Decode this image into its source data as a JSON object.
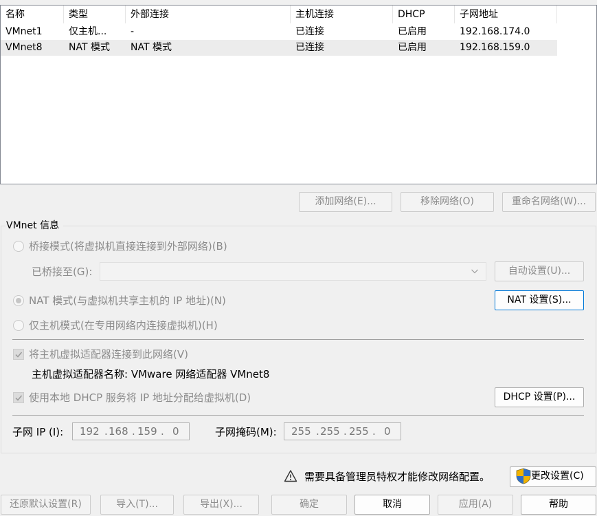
{
  "network_list": {
    "columns": [
      "名称",
      "类型",
      "外部连接",
      "主机连接",
      "DHCP",
      "子网地址"
    ],
    "rows": [
      {
        "name": "VMnet1",
        "type": "仅主机...",
        "external": "-",
        "host": "已连接",
        "dhcp": "已启用",
        "subnet": "192.168.174.0"
      },
      {
        "name": "VMnet8",
        "type": "NAT 模式",
        "external": "NAT 模式",
        "host": "已连接",
        "dhcp": "已启用",
        "subnet": "192.168.159.0"
      }
    ],
    "selected_row": "VMnet8"
  },
  "list_buttons": {
    "add": "添加网络(E)...",
    "remove": "移除网络(O)",
    "rename": "重命名网络(W)..."
  },
  "vmnet_info": {
    "title": "VMnet 信息",
    "bridged_label": "桥接模式(将虚拟机直接连接到外部网络)(B)",
    "bridged_to_label": "已桥接至(G):",
    "bridged_to_value": "",
    "auto_settings": "自动设置(U)...",
    "nat_label": "NAT 模式(与虚拟机共享主机的 IP 地址)(N)",
    "nat_settings": "NAT 设置(S)...",
    "host_only_label": "仅主机模式(在专用网络内连接虚拟机)(H)",
    "connect_adapter_label": "将主机虚拟适配器连接到此网络(V)",
    "adapter_name_text": "主机虚拟适配器名称: VMware 网络适配器 VMnet8",
    "dhcp_label": "使用本地 DHCP 服务将 IP 地址分配给虚拟机(D)",
    "dhcp_settings": "DHCP 设置(P)...",
    "mode_selected": "nat",
    "connect_adapter_checked": true,
    "dhcp_checked": true,
    "subnet_ip_label": "子网 IP (I):",
    "subnet_ip": [
      "192",
      "168",
      "159",
      "0"
    ],
    "subnet_mask_label": "子网掩码(M):",
    "subnet_mask": [
      "255",
      "255",
      "255",
      "0"
    ]
  },
  "admin_notice": "需要具备管理员特权才能修改网络配置。",
  "change_settings": "更改设置(C)",
  "footer_buttons": {
    "restore": "还原默认设置(R)",
    "import": "导入(T)...",
    "export": "导出(X)...",
    "ok": "确定",
    "cancel": "取消",
    "apply": "应用(A)",
    "help": "帮助"
  },
  "icons": {
    "warning": "warning-triangle-icon",
    "shield": "uac-shield-icon",
    "dropdown": "chevron-down-icon",
    "check": "checkmark-icon"
  },
  "colors": {
    "focus_border": "#0078d7",
    "disabled_text": "#8b8b8b",
    "selected_row": "#ececec"
  }
}
